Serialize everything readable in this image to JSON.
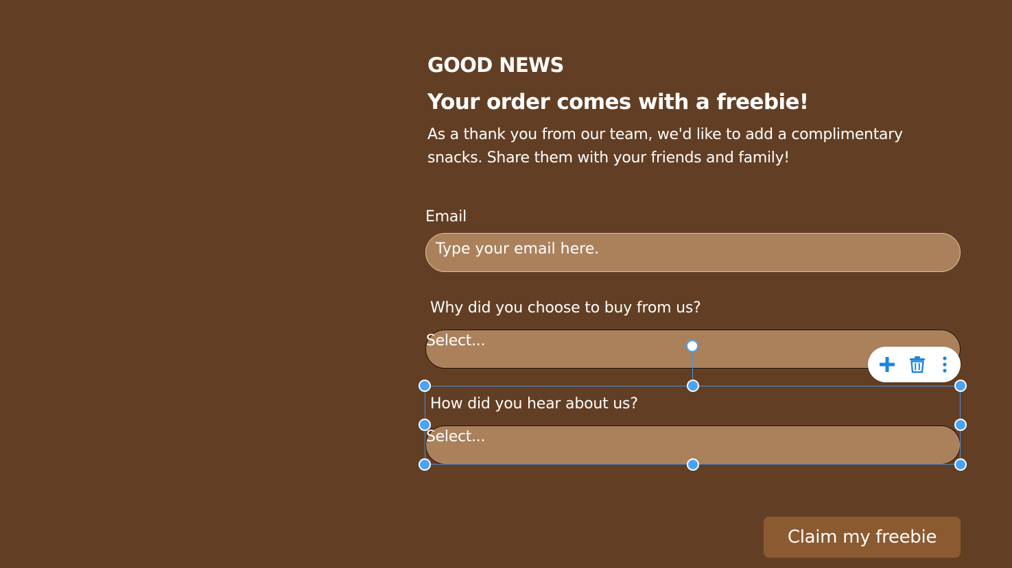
{
  "colors": {
    "background": "#623f24",
    "field_fill": "#ab815c",
    "button_fill": "#8c5a31",
    "selection_accent": "#4aa3f5",
    "toolbar_icon": "#1a85e0"
  },
  "hero": {
    "eyebrow": "GOOD NEWS",
    "headline": "Your order comes with a freebie!",
    "body": "As a thank you from our team, we'd like to add a complimentary snacks. Share them with your friends and family!"
  },
  "form": {
    "email": {
      "label": "Email",
      "placeholder": "Type your email here."
    },
    "why_buy": {
      "label": "Why did you choose to buy from us?",
      "selected": "Select..."
    },
    "hear_about": {
      "label": "How did you hear about us?",
      "selected": "Select..."
    },
    "submit_label": "Claim my freebie"
  },
  "toolbar": {
    "icons": [
      "plus-icon",
      "trash-icon",
      "more-vertical-icon"
    ]
  }
}
